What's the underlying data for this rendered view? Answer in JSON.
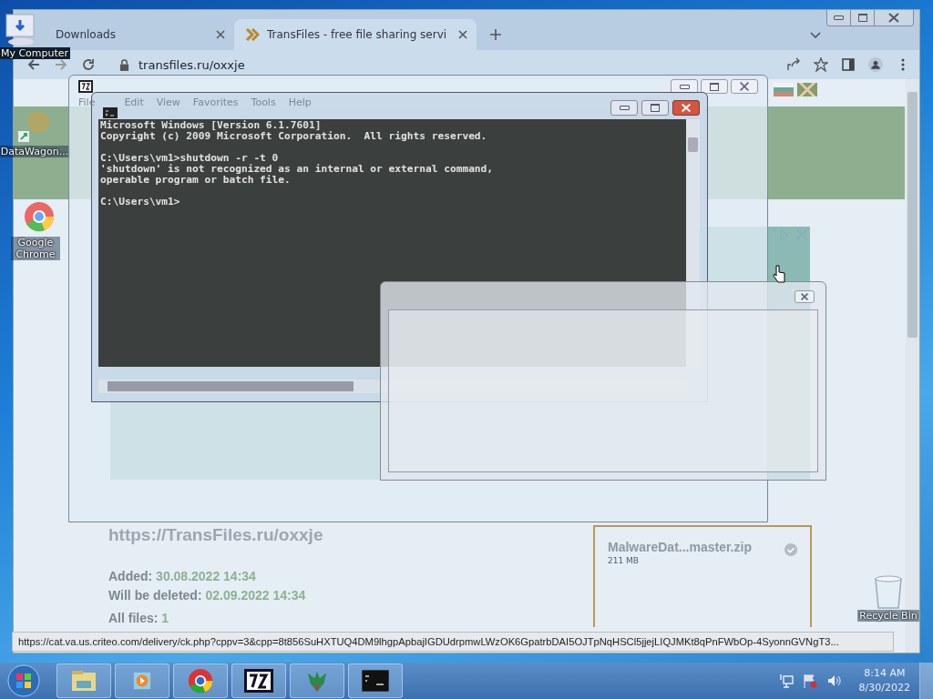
{
  "desktop_icons": [
    {
      "label": "My Computer",
      "kind": "computer"
    },
    {
      "label": "DataWagon...",
      "kind": "app"
    },
    {
      "label": "Google Chrome",
      "kind": "chrome"
    },
    {
      "label": "Recycle Bin",
      "kind": "bin"
    }
  ],
  "browser": {
    "tabs": [
      {
        "label": "Downloads",
        "selected": false
      },
      {
        "label": "TransFiles - free file sharing servi",
        "selected": true
      }
    ],
    "address": "transfiles.ru/oxxje",
    "page": {
      "link": "https://TransFiles.ru/oxxje",
      "added_label": "Added:",
      "added": "30.08.2022 14:34",
      "deleted_label": "Will be deleted:",
      "deleted": "02.09.2022 14:34",
      "files_label": "All files:",
      "files_count": "1",
      "file": {
        "name": "MalwareDat...master.zip",
        "size": "211 MB"
      }
    },
    "status_url": "https://cat.va.us.criteo.com/delivery/ck.php?cppv=3&cpp=8t856SuHXTUQ4DM9lhgpApbajIGDUdrpmwLWzOK6GpatrbDAI5OJTpNqHSCl5jjejLIQJMKt8qPnFWbOp-4SyonnGVNgT3..."
  },
  "archiver": {
    "menu": [
      "File",
      "Edit",
      "View",
      "Favorites",
      "Tools",
      "Help"
    ]
  },
  "console": {
    "blocks": [
      [
        "Microsoft Windows [Version 6.1.7601]",
        "Copyright (c) 2009 Microsoft Corporation.  All rights reserved."
      ],
      [
        "C:\\Users\\vm1>shutdown -r -t 0",
        "'shutdown' is not recognized as an internal or external command,",
        "operable program or batch file."
      ],
      [
        "C:\\Users\\vm1>"
      ]
    ]
  },
  "taskbar": {
    "apps": [
      {
        "kind": "explorer"
      },
      {
        "kind": "media"
      },
      {
        "kind": "chrome"
      },
      {
        "kind": "archiver"
      },
      {
        "kind": "dragon"
      },
      {
        "kind": "console"
      }
    ],
    "time": "8:14 AM",
    "date": "8/30/2022"
  }
}
